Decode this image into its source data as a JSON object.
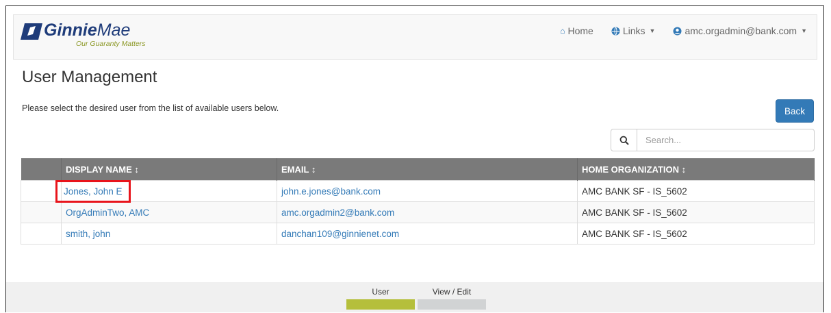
{
  "navbar": {
    "logo_brand_bold": "Ginnie",
    "logo_brand_light": "Mae",
    "logo_tagline": "Our Guaranty Matters",
    "home_label": "Home",
    "links_label": "Links",
    "user_label": "amc.orgadmin@bank.com"
  },
  "page": {
    "title": "User Management",
    "instructions": "Please select the desired user from the list of available users below.",
    "back_label": "Back",
    "search_placeholder": "Search..."
  },
  "table": {
    "headers": [
      "DISPLAY NAME ↕",
      "EMAIL ↕",
      "HOME ORGANIZATION ↕"
    ],
    "rows": [
      {
        "name": "Jones, John E",
        "email": "john.e.jones@bank.com",
        "org": "AMC BANK SF - IS_5602"
      },
      {
        "name": "OrgAdminTwo, AMC",
        "email": "amc.orgadmin2@bank.com",
        "org": "AMC BANK SF - IS_5602"
      },
      {
        "name": "smith, john",
        "email": "danchan109@ginnienet.com",
        "org": "AMC BANK SF - IS_5602"
      }
    ]
  },
  "progress": {
    "steps": [
      {
        "label": "User",
        "color": "#b5bf3b",
        "active": true
      },
      {
        "label": "View / Edit",
        "color": "#d1d3d4",
        "active": false
      }
    ]
  },
  "colors": {
    "primary": "#337ab7",
    "header_gray": "#7a7a7a",
    "highlight_red": "#e8141b"
  }
}
